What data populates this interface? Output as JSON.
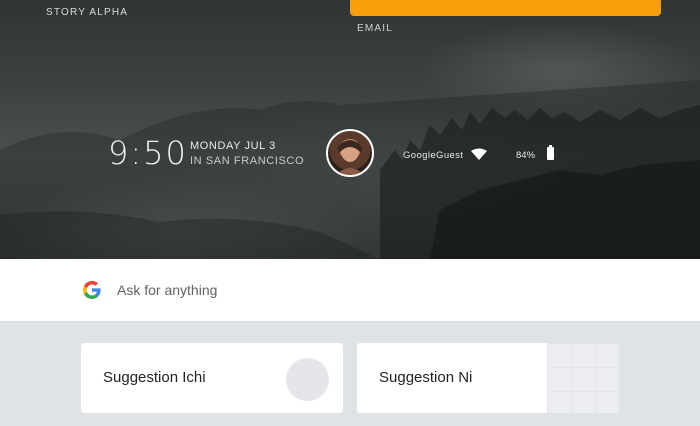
{
  "header": {
    "story_title": "STORY ALPHA",
    "email_label": "EMAIL"
  },
  "status": {
    "time": "9:50",
    "date": "MONDAY JUL 3",
    "location": "IN SAN FRANCISCO",
    "wifi_name": "GoogleGuest",
    "battery": "84%"
  },
  "search": {
    "placeholder": "Ask for anything",
    "icon": "google-g-icon"
  },
  "suggestions": [
    {
      "label": "Suggestion Ichi"
    },
    {
      "label": "Suggestion Ni"
    }
  ],
  "colors": {
    "accent_orange": "#f99e0b",
    "background": "#dfe3e6",
    "google_blue": "#4285f4",
    "google_red": "#ea4335",
    "google_yellow": "#fbbc05",
    "google_green": "#34a853"
  }
}
